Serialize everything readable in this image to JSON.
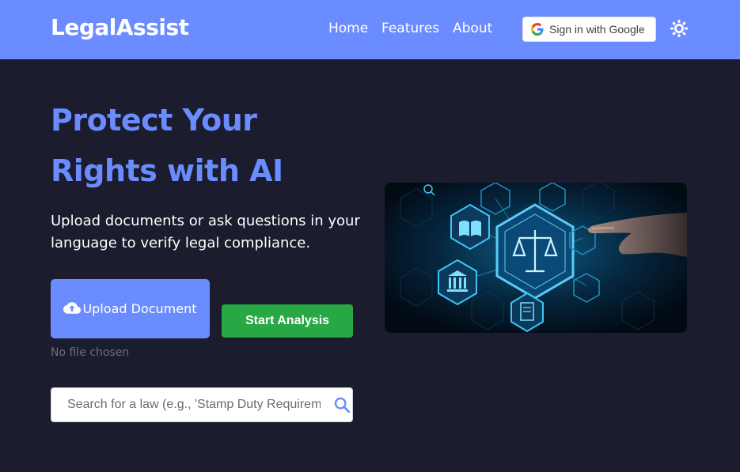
{
  "navbar": {
    "brand": "LegalAssist",
    "links": [
      {
        "label": "Home"
      },
      {
        "label": "Features"
      },
      {
        "label": "About"
      }
    ],
    "google_signin_label": "Sign in with Google",
    "theme_toggle_icon": "sun-icon",
    "background_color": "#6b8cfe"
  },
  "hero": {
    "title_line1": "Protect Your",
    "title_line2": "Rights with AI",
    "subtitle": "Upload documents or ask questions in your language to verify legal compliance.",
    "upload_label": "Upload Document",
    "upload_icon": "cloud-upload-icon",
    "start_label": "Start Analysis",
    "file_status": "No file chosen",
    "search_placeholder": "Search for a law (e.g., 'Stamp Duty Requirements')",
    "search_icon": "search-icon",
    "image_alt": "ai-legal-illustration"
  },
  "colors": {
    "accent": "#6b8cfe",
    "background": "#1b1c2d",
    "start_button": "#28a745",
    "muted_text": "#6d6f7a"
  }
}
